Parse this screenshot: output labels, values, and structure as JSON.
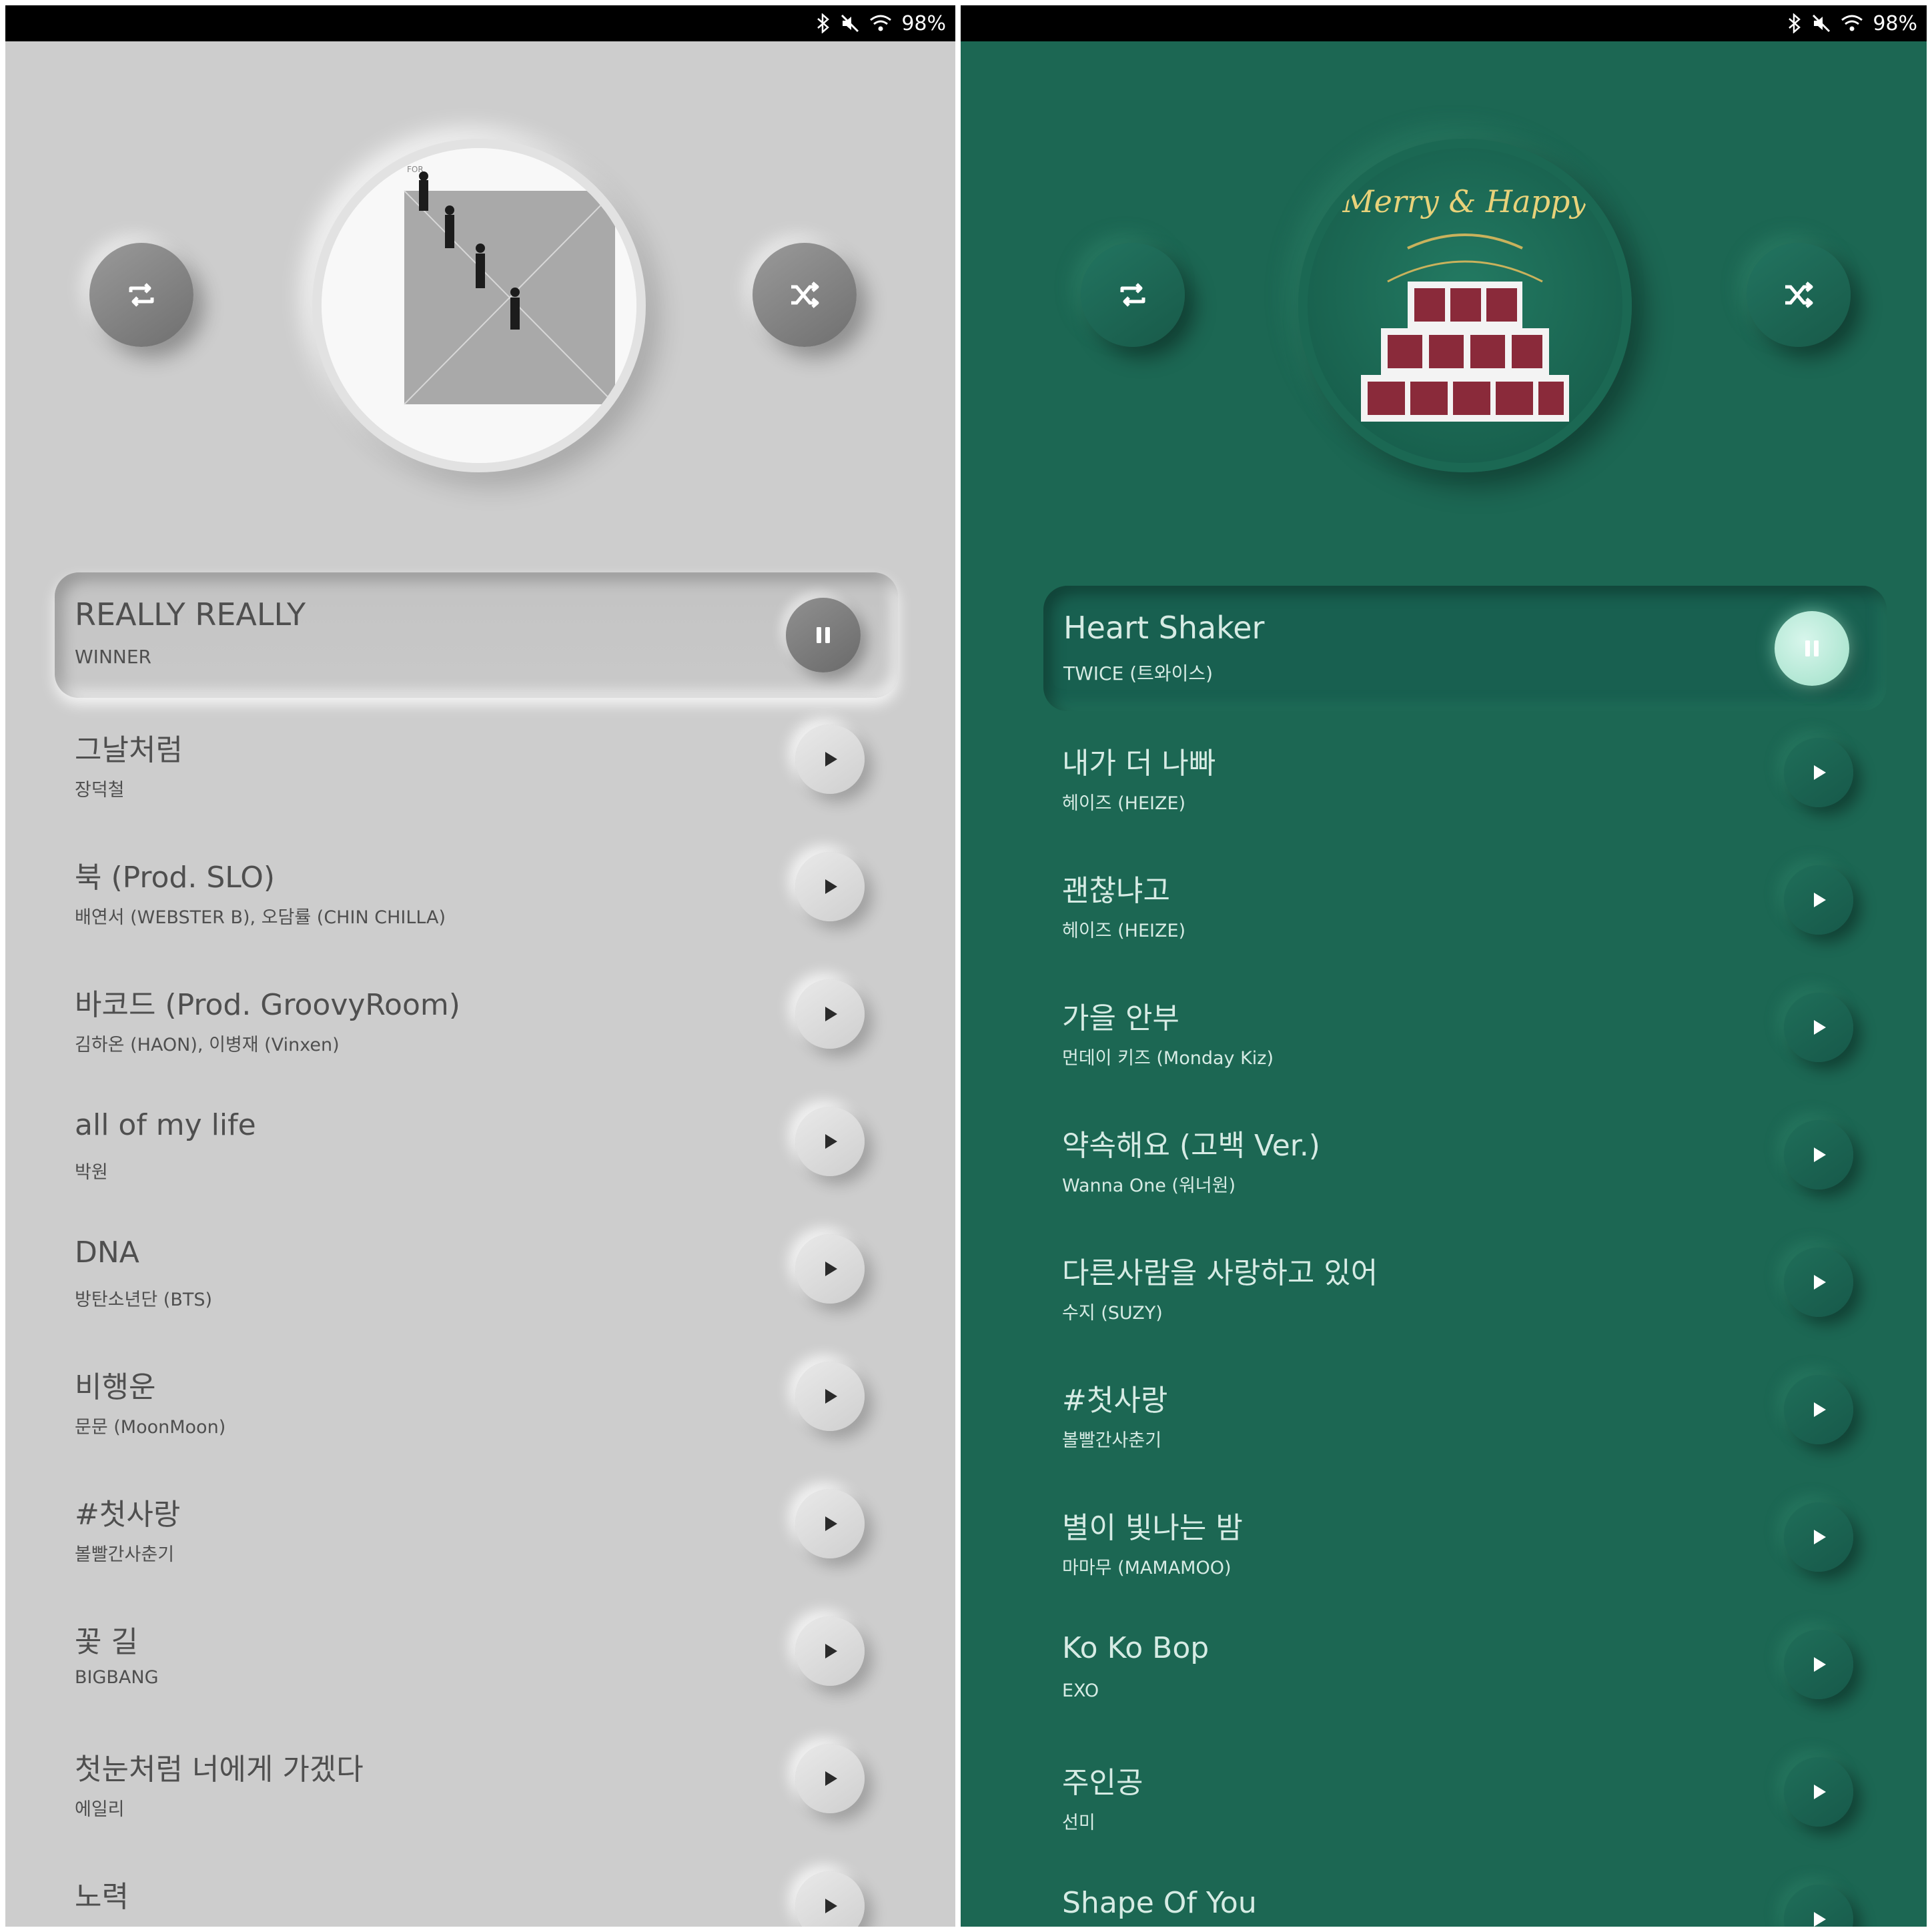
{
  "colors": {
    "light_bg": "#cdcdcd",
    "green_bg": "#1c6753",
    "light_text": "#4f4f4f",
    "green_text": "#d6ebe4",
    "green_accent": "#b8eedb"
  },
  "left": {
    "status": {
      "battery": "98%"
    },
    "controls": {
      "repeat_icon": "repeat-icon",
      "shuffle_icon": "shuffle-icon"
    },
    "album_art": {
      "caption": "FOR"
    },
    "now_playing": {
      "title": "REALLY REALLY",
      "artist": "WINNER",
      "state_icon": "pause-icon"
    },
    "songs": [
      {
        "title": "그날처럼",
        "artist": "장덕철"
      },
      {
        "title": "북 (Prod. SLO)",
        "artist": "배연서 (WEBSTER B), 오담률 (CHIN CHILLA)"
      },
      {
        "title": "바코드 (Prod. GroovyRoom)",
        "artist": "김하온 (HAON), 이병재 (Vinxen)"
      },
      {
        "title": "all of my life",
        "artist": "박원"
      },
      {
        "title": "DNA",
        "artist": "방탄소년단 (BTS)"
      },
      {
        "title": "비행운",
        "artist": "문문 (MoonMoon)"
      },
      {
        "title": "#첫사랑",
        "artist": "볼빨간사춘기"
      },
      {
        "title": "꽃 길",
        "artist": "BIGBANG"
      },
      {
        "title": "첫눈처럼 너에게 가겠다",
        "artist": "에일리"
      },
      {
        "title": "노력",
        "artist": ""
      }
    ]
  },
  "right": {
    "status": {
      "battery": "98%"
    },
    "controls": {
      "repeat_icon": "repeat-icon",
      "shuffle_icon": "shuffle-icon"
    },
    "album_art": {
      "caption": "Merry & Happy"
    },
    "now_playing": {
      "title": "Heart Shaker",
      "artist": "TWICE (트와이스)",
      "state_icon": "pause-icon"
    },
    "songs": [
      {
        "title": "내가 더 나빠",
        "artist": "헤이즈 (HEIZE)"
      },
      {
        "title": "괜찮냐고",
        "artist": "헤이즈 (HEIZE)"
      },
      {
        "title": "가을 안부",
        "artist": "먼데이 키즈 (Monday Kiz)"
      },
      {
        "title": "약속해요 (고백 Ver.)",
        "artist": "Wanna One (워너원)"
      },
      {
        "title": "다른사람을 사랑하고 있어",
        "artist": "수지 (SUZY)"
      },
      {
        "title": "#첫사랑",
        "artist": "볼빨간사춘기"
      },
      {
        "title": "별이 빛나는 밤",
        "artist": "마마무 (MAMAMOO)"
      },
      {
        "title": "Ko Ko Bop",
        "artist": "EXO"
      },
      {
        "title": "주인공",
        "artist": "선미"
      },
      {
        "title": "Shape Of You",
        "artist": ""
      }
    ]
  }
}
